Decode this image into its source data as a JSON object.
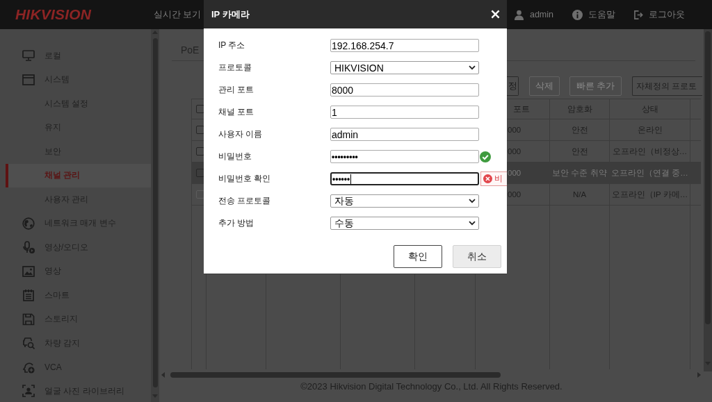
{
  "top_bar": {
    "logo": "HIKVISION",
    "nav": [
      {
        "label": "실시간 보기"
      }
    ],
    "links": [
      {
        "kind": "user",
        "label": "admin"
      },
      {
        "kind": "help",
        "label": "도움말"
      },
      {
        "kind": "logout",
        "label": "로그아웃"
      }
    ]
  },
  "sidebar": {
    "items": [
      {
        "label": "로컬",
        "selected": false
      },
      {
        "label": "시스템",
        "selected": false,
        "children": [
          {
            "label": "시스템 설정",
            "selected": false
          },
          {
            "label": "유지",
            "selected": false
          },
          {
            "label": "보안",
            "selected": false
          },
          {
            "label": "채널 관리",
            "selected": true
          },
          {
            "label": "사용자 관리",
            "selected": false
          }
        ]
      },
      {
        "label": "네트워크 매개 변수",
        "selected": false
      },
      {
        "label": "영상/오디오",
        "selected": false
      },
      {
        "label": "영상",
        "selected": false
      },
      {
        "label": "스마트",
        "selected": false
      },
      {
        "label": "스토리지",
        "selected": false
      },
      {
        "label": "차량 감지",
        "selected": false
      },
      {
        "label": "VCA",
        "selected": false
      },
      {
        "label": "얼굴 사진 라이브러리",
        "selected": false
      }
    ]
  },
  "main": {
    "tabs": [
      {
        "label": "PoE"
      }
    ],
    "toolbar": [
      {
        "label": "정",
        "disabled": false
      },
      {
        "label": "삭제",
        "disabled": true
      },
      {
        "label": "빠른 추가",
        "disabled": true
      },
      {
        "label": "자체정의 프로토",
        "disabled": false
      }
    ],
    "table": {
      "header_checkbox": {
        "checked": false
      },
      "columns": [
        "포트",
        "암호화",
        "상태"
      ],
      "rows": [
        {
          "checked": false,
          "disabled": false,
          "selected": false,
          "cells": [
            "000",
            "안전",
            "온라인"
          ]
        },
        {
          "checked": false,
          "disabled": false,
          "selected": false,
          "cells": [
            "000",
            "안전",
            "오프라인（비정상…"
          ]
        },
        {
          "checked": false,
          "disabled": false,
          "selected": true,
          "cells": [
            "000",
            "보안 수준 취약",
            "오프라인（연결 중…"
          ]
        },
        {
          "checked": false,
          "disabled": true,
          "selected": false,
          "cells": [
            "000",
            "N/A",
            "오프라인（IP 카메…"
          ]
        }
      ]
    },
    "footer": "©2023 Hikvision Digital Technology Co., Ltd. All Rights Reserved."
  },
  "dialog": {
    "title": "IP 카메라",
    "fields": [
      {
        "label": "IP 주소",
        "kind": "text",
        "value": "192.168.254.7",
        "focused": false
      },
      {
        "label": "프로토콜",
        "kind": "select",
        "value": "HIKVISION",
        "focused": false
      },
      {
        "label": "관리 포트",
        "kind": "text",
        "value": "8000",
        "focused": false
      },
      {
        "label": "채널 포트",
        "kind": "text",
        "value": "1",
        "focused": false
      },
      {
        "label": "사용자 이름",
        "kind": "text",
        "value": "admin",
        "focused": false
      },
      {
        "label": "비밀번호",
        "kind": "password",
        "value": "•••••••••",
        "focused": false,
        "valid": true
      },
      {
        "label": "비밀번호 확인",
        "kind": "password",
        "value": "••••••",
        "focused": true,
        "error": "비"
      },
      {
        "label": "전송 프로토콜",
        "kind": "select",
        "value": "자동",
        "focused": false
      },
      {
        "label": "추가 방법",
        "kind": "select",
        "value": "수동",
        "focused": false
      }
    ],
    "buttons": [
      {
        "label": "확인",
        "kind": "primary"
      },
      {
        "label": "취소",
        "kind": "secondary"
      }
    ]
  }
}
